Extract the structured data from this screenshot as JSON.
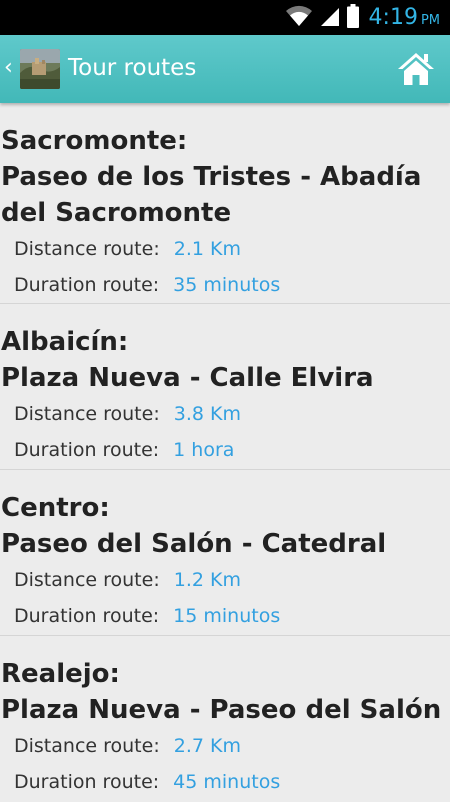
{
  "status_bar": {
    "time": "4:19",
    "ampm": "PM",
    "icons": [
      "wifi-icon",
      "signal-icon",
      "battery-icon"
    ]
  },
  "action_bar": {
    "title": "Tour routes",
    "home_icon": "home-icon"
  },
  "routes": [
    {
      "area": "Sacromonte:",
      "path": "Paseo de los Tristes - Abadía del Sacromonte",
      "distance_label": "Distance route:",
      "distance": "2.1 Km",
      "duration_label": "Duration route:",
      "duration": "35 minutos"
    },
    {
      "area": "Albaicín:",
      "path": "Plaza Nueva - Calle Elvira",
      "distance_label": "Distance route:",
      "distance": "3.8 Km",
      "duration_label": "Duration route:",
      "duration": "1 hora"
    },
    {
      "area": "Centro:",
      "path": "Paseo del Salón - Catedral",
      "distance_label": "Distance route:",
      "distance": "1.2 Km",
      "duration_label": "Duration route:",
      "duration": "15 minutos"
    },
    {
      "area": "Realejo:",
      "path": "Plaza Nueva - Paseo del Salón",
      "distance_label": "Distance route:",
      "distance": "2.7 Km",
      "duration_label": "Duration route:",
      "duration": "45 minutos"
    }
  ]
}
